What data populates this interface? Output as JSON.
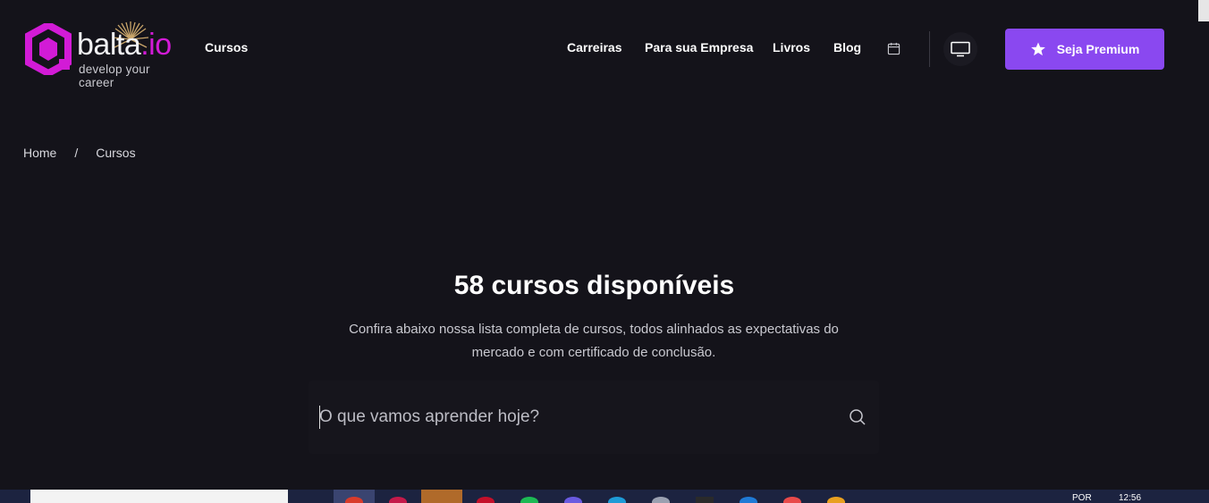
{
  "header": {
    "logo": {
      "name": "balta",
      "tld": ".io",
      "tagline": "develop your career"
    },
    "nav_left": [
      {
        "label": "Cursos"
      }
    ],
    "nav_right": [
      {
        "label": "Carreiras"
      },
      {
        "label": "Para sua Empresa"
      },
      {
        "label": "Livros"
      },
      {
        "label": "Blog"
      }
    ],
    "icons": {
      "calendar": "calendar-icon",
      "tv": "tv-icon",
      "star": "star-icon"
    },
    "premium_button": "Seja Premium"
  },
  "breadcrumb": {
    "items": [
      "Home",
      "Cursos"
    ],
    "separator": "/"
  },
  "hero": {
    "title": "58 cursos disponíveis",
    "description": "Confira abaixo nossa lista completa de cursos, todos alinhados as expectativas do mercado e com certificado de conclusão."
  },
  "search": {
    "placeholder": "O que vamos aprender hoje?",
    "value": ""
  },
  "taskbar": {
    "language": "POR",
    "time": "12:56"
  },
  "colors": {
    "background": "#14131a",
    "accent": "#8a48f0",
    "logo_magenta": "#d21bd6",
    "text": "#ffffff",
    "muted_text": "#c9c9d0"
  }
}
